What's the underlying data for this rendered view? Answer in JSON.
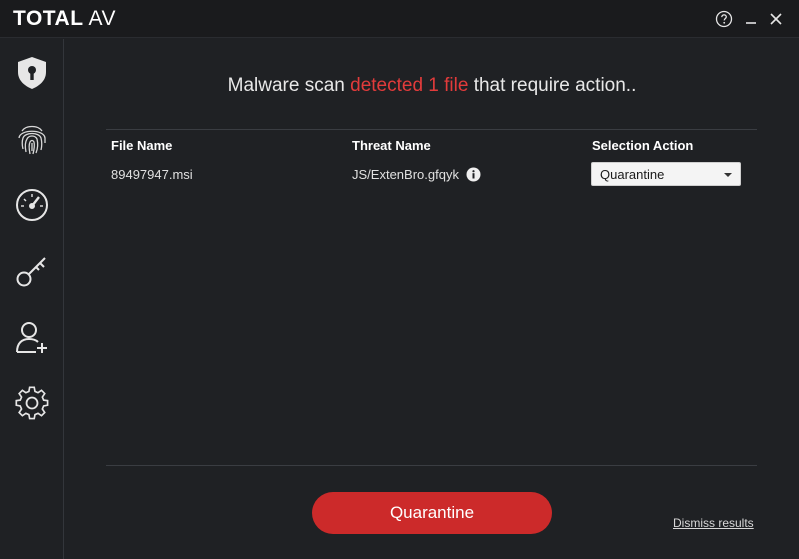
{
  "app": {
    "brand_bold": "TOTAL",
    "brand_light": "AV",
    "help_icon": "help-circle-icon",
    "minimize_icon": "minimize-icon",
    "close_icon": "close-icon"
  },
  "sidebar": {
    "items": [
      {
        "icon": "shield-lock-icon"
      },
      {
        "icon": "fingerprint-icon"
      },
      {
        "icon": "speedometer-icon"
      },
      {
        "icon": "key-icon"
      },
      {
        "icon": "add-user-icon"
      },
      {
        "icon": "gear-icon"
      }
    ]
  },
  "main": {
    "headline_prefix": "Malware scan ",
    "headline_highlight": "detected 1 file",
    "headline_suffix": " that require action..",
    "columns": [
      "File Name",
      "Threat Name",
      "Selection Action"
    ],
    "rows": [
      {
        "file_name": "89497947.msi",
        "threat_name": "JS/ExtenBro.gfqyk",
        "action": "Quarantine"
      }
    ],
    "primary_button": "Quarantine",
    "dismiss_link": "Dismiss results"
  },
  "colors": {
    "background": "#1f2124",
    "accent_red": "#cc2a2a",
    "highlight_red": "#e23b3b"
  }
}
